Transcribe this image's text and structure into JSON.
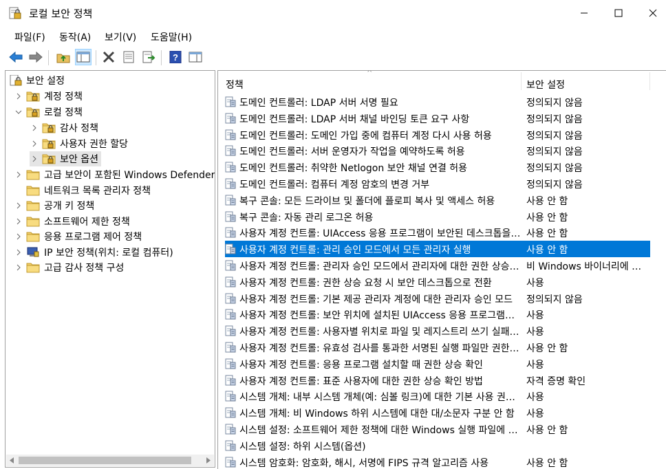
{
  "window": {
    "title": "로컬 보안 정책"
  },
  "menu": [
    "파일(F)",
    "동작(A)",
    "보기(V)",
    "도움말(H)"
  ],
  "toolbar": [
    "back-icon",
    "forward-icon",
    "up-folder-icon",
    "show-hide-tree-icon",
    "delete-icon",
    "properties-icon",
    "export-list-icon",
    "help-icon",
    "console-tree-icon"
  ],
  "tree": {
    "root": "보안 설정",
    "items": [
      {
        "label": "계정 정책",
        "level": 1,
        "arrow": ">"
      },
      {
        "label": "로컬 정책",
        "level": 1,
        "arrow": "v"
      },
      {
        "label": "감사 정책",
        "level": 2,
        "arrow": ">"
      },
      {
        "label": "사용자 권한 할당",
        "level": 2,
        "arrow": ">"
      },
      {
        "label": "보안 옵션",
        "level": 2,
        "arrow": ">"
      },
      {
        "label": "고급 보안이 포함된 Windows Defender",
        "level": 1,
        "arrow": ">"
      },
      {
        "label": "네트워크 목록 관리자 정책",
        "level": 1,
        "arrow": ""
      },
      {
        "label": "공개 키 정책",
        "level": 1,
        "arrow": ">"
      },
      {
        "label": "소프트웨어 제한 정책",
        "level": 1,
        "arrow": ">"
      },
      {
        "label": "응용 프로그램 제어 정책",
        "level": 1,
        "arrow": ">"
      },
      {
        "label": "IP 보안 정책(위치: 로컬 컴퓨터)",
        "level": 1,
        "arrow": ">"
      },
      {
        "label": "고급 감사 정책 구성",
        "level": 1,
        "arrow": ">"
      }
    ]
  },
  "list": {
    "headers": {
      "policy": "정책",
      "setting": "보안 설정"
    },
    "rows": [
      {
        "policy": "도메인 컨트롤러: LDAP 서버 서명 필요",
        "setting": "정의되지 않음"
      },
      {
        "policy": "도메인 컨트롤러: LDAP 서버 채널 바인딩 토큰 요구 사항",
        "setting": "정의되지 않음"
      },
      {
        "policy": "도메인 컨트롤러: 도메인 가입 중에 컴퓨터 계정 다시 사용 허용",
        "setting": "정의되지 않음"
      },
      {
        "policy": "도메인 컨트롤러: 서버 운영자가 작업을 예약하도록 허용",
        "setting": "정의되지 않음"
      },
      {
        "policy": "도메인 컨트롤러: 취약한 Netlogon 보안 채널 연결 허용",
        "setting": "정의되지 않음"
      },
      {
        "policy": "도메인 컨트롤러: 컴퓨터 계정 암호의 변경 거부",
        "setting": "정의되지 않음"
      },
      {
        "policy": "복구 콘솔: 모든 드라이브 및 폴더에 플로피 복사 및 액세스 허용",
        "setting": "사용 안 함"
      },
      {
        "policy": "복구 콘솔: 자동 관리 로그온 허용",
        "setting": "사용 안 함"
      },
      {
        "policy": "사용자 계정 컨트롤: UIAccess 응용 프로그램이 보안된 데스크톱을 사용하지 않고",
        "setting": "사용 안 함"
      },
      {
        "policy": "사용자 계정 컨트롤: 관리 승인 모드에서 모든 관리자 실행",
        "setting": "사용 안 함",
        "selected": true
      },
      {
        "policy": "사용자 계정 컨트롤: 관리자 승인 모드에서 관리자에 대한 권한 상승 확인",
        "setting": "비 Windows 바이너리에 대한 동의 확인"
      },
      {
        "policy": "사용자 계정 컨트롤: 권한 상승 요청 시 보안 데스크톱으로 전환",
        "setting": "사용"
      },
      {
        "policy": "사용자 계정 컨트롤: 기본 제공 관리자 계정에 대한 관리자 승인 모드",
        "setting": "정의되지 않음"
      },
      {
        "policy": "사용자 계정 컨트롤: 보안 위치에 설치된 UIAccess 응용 프로그램만 권한 상승",
        "setting": "사용"
      },
      {
        "policy": "사용자 계정 컨트롤: 사용자별 위치로 파일 및 레지스트리 쓰기 실패 가상화",
        "setting": "사용"
      },
      {
        "policy": "사용자 계정 컨트롤: 유효성 검사를 통과한 서명된 실행 파일만 권한 상승",
        "setting": "사용 안 함"
      },
      {
        "policy": "사용자 계정 컨트롤: 응용 프로그램 설치할 때 권한 상승 확인",
        "setting": "사용"
      },
      {
        "policy": "사용자 계정 컨트롤: 표준 사용자에 대한 권한 상승 확인 방법",
        "setting": "자격 증명 확인"
      },
      {
        "policy": "시스템 개체: 내부 시스템 개체(예: 심볼 링크)에 대한 기본 사용 권한 강화",
        "setting": "사용"
      },
      {
        "policy": "시스템 개체: 비 Windows 하위 시스템에 대한 대/소문자 구분 안 함",
        "setting": "사용"
      },
      {
        "policy": "시스템 설정: 소프트웨어 제한 정책에 대한 Windows 실행 파일에 인증서 규칙 사용",
        "setting": "사용 안 함"
      },
      {
        "policy": "시스템 설정: 하위 시스템(옵션)",
        "setting": ""
      },
      {
        "policy": "시스템 암호화: 암호화, 해시, 서명에 FIPS 규격 알고리즘 사용",
        "setting": "사용 안 함"
      }
    ]
  }
}
